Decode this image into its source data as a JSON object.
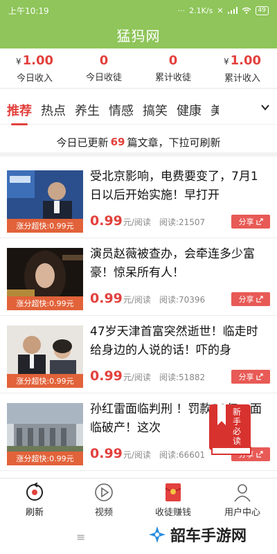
{
  "status": {
    "time": "上午10:19",
    "dots": "···",
    "speed": "2.1K/s",
    "battery": "49"
  },
  "header": {
    "title": "猛犸网"
  },
  "stats": [
    {
      "currency": "¥",
      "value": "1.00",
      "label": "今日收入"
    },
    {
      "currency": "",
      "value": "0",
      "label": "今日收徒"
    },
    {
      "currency": "",
      "value": "0",
      "label": "累计收徒"
    },
    {
      "currency": "¥",
      "value": "1.00",
      "label": "累计收入"
    }
  ],
  "tabs": [
    "推荐",
    "热点",
    "养生",
    "情感",
    "搞笑",
    "健康",
    "美"
  ],
  "notice": {
    "prefix": "今日已更新",
    "count": "69",
    "suffix": "篇文章，下拉可刷新"
  },
  "articles": [
    {
      "title": "受北京影响，电费要变了，7月1日以后开始实施！早打开",
      "tag": "涨分超快:0.99元",
      "price": "0.99",
      "unit": "元/阅读",
      "reads": "阅读:21507",
      "share": "分享"
    },
    {
      "title": "演员赵薇被查办，会牵连多少富豪！惊呆所有人！",
      "tag": "涨分超快:0.99元",
      "price": "0.99",
      "unit": "元/阅读",
      "reads": "阅读:70396",
      "share": "分享"
    },
    {
      "title": "47岁天津首富突然逝世！临走时给身边的人说的话！吓的身",
      "tag": "涨分超快:0.99元",
      "price": "0.99",
      "unit": "元/阅读",
      "reads": "阅读:51882",
      "share": "分享"
    },
    {
      "title": "孙红雷面临判刑 ！罚款20亿，面临破产！这次",
      "tag": "涨分超快:0.99元",
      "price": "0.99",
      "unit": "元/阅读",
      "reads": "阅读:66601",
      "share": "分享"
    }
  ],
  "nav": [
    {
      "label": "刷新",
      "icon": "refresh-icon"
    },
    {
      "label": "视频",
      "icon": "play-icon"
    },
    {
      "label": "收徒赚钱",
      "icon": "red-envelope-icon"
    },
    {
      "label": "用户中心",
      "icon": "user-icon"
    }
  ],
  "badge": {
    "text": "新手必读"
  },
  "watermark": {
    "text": "韶车手游网"
  },
  "colors": {
    "brand_green": "#8fc55a",
    "accent_red": "#e2413d",
    "tag_orange": "#e2623a"
  }
}
